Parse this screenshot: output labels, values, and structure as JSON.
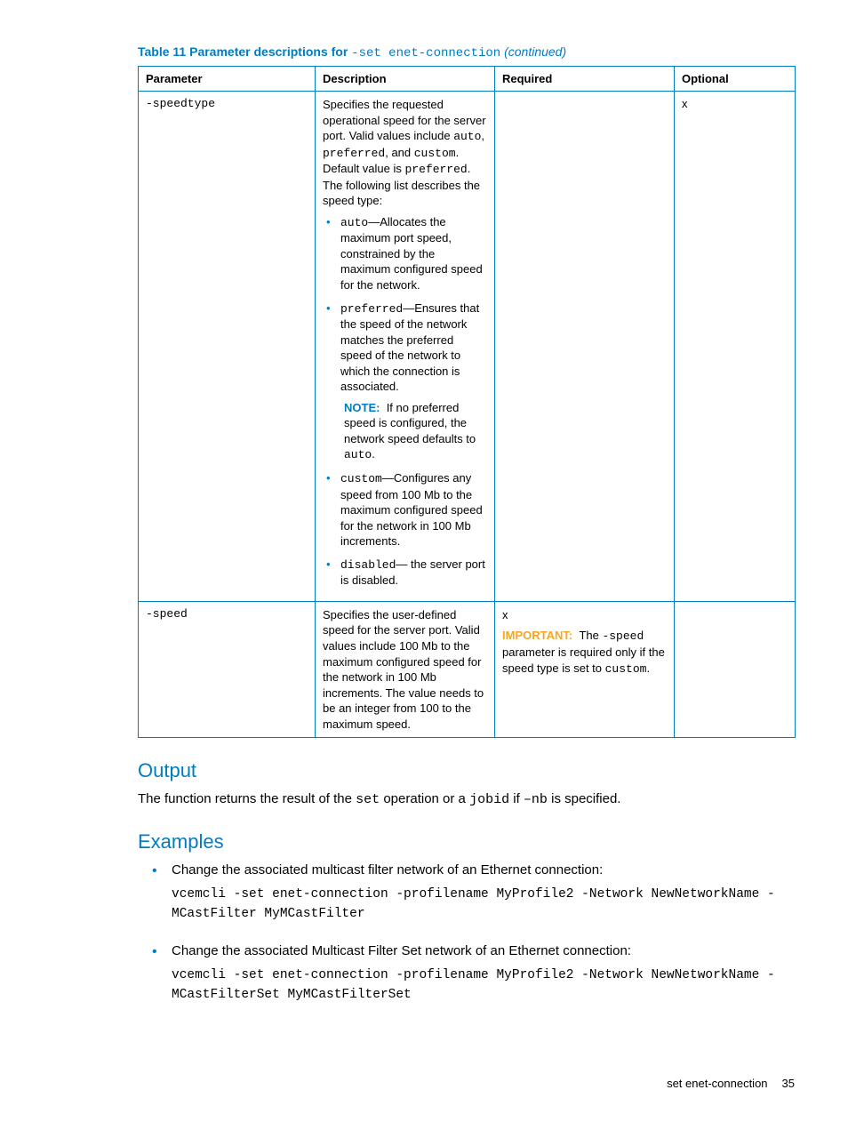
{
  "caption": {
    "prefix": "Table 11 Parameter descriptions for ",
    "code": "-set enet-connection",
    "suffix": " (continued)"
  },
  "headers": {
    "c1": "Parameter",
    "c2": "Description",
    "c3": "Required",
    "c4": "Optional"
  },
  "row1": {
    "param": "-speedtype",
    "desc_intro_a": "Specifies the requested operational speed for the server port. Valid values include ",
    "desc_code1": "auto",
    "desc_sep1": ", ",
    "desc_code2": "preferred",
    "desc_sep2": ", and ",
    "desc_code3": "custom",
    "desc_aftercodes": ". Default value is ",
    "desc_code4": "preferred",
    "desc_tail": ". The following list describes the speed type:",
    "b1_code": "auto",
    "b1_text": "—Allocates the maximum port speed, constrained by the maximum configured speed for the network.",
    "b2_code": "preferred",
    "b2_text": "—Ensures that the speed of the network matches the preferred speed of the network to which the connection is associated.",
    "b2_note_label": "NOTE:",
    "b2_note_text_a": "If no preferred speed is configured, the network speed defaults to ",
    "b2_note_code": "auto",
    "b2_note_text_b": ".",
    "b3_code": "custom",
    "b3_text": "—Configures any speed from 100 Mb to the maximum configured speed for the network in 100 Mb increments.",
    "b4_code": "disabled",
    "b4_text": "— the server port is disabled.",
    "required": "",
    "optional": "x"
  },
  "row2": {
    "param": "-speed",
    "desc": "Specifies the user-defined speed for the server port. Valid values include 100 Mb to the maximum configured speed for the network in 100 Mb increments. The value needs to be an integer from 100 to the maximum speed.",
    "req_x": "x",
    "imp_label": "IMPORTANT:",
    "imp_text_a": "The ",
    "imp_code": "-speed",
    "imp_text_b": " parameter is required only if the speed type is set to ",
    "imp_code2": "custom",
    "imp_text_c": ".",
    "optional": ""
  },
  "output": {
    "heading": "Output",
    "text_a": "The function returns the result of the ",
    "code1": "set",
    "text_b": " operation or a ",
    "code2": "jobid",
    "text_c": " if ",
    "code3": "–nb",
    "text_d": " is specified."
  },
  "examples": {
    "heading": "Examples",
    "item1_text": "Change the associated multicast filter network of an Ethernet connection:",
    "item1_cmd": "vcemcli -set enet-connection -profilename MyProfile2 -Network NewNetworkName -MCastFilter MyMCastFilter",
    "item2_text": "Change the associated Multicast Filter Set network of an Ethernet connection:",
    "item2_cmd": "vcemcli -set enet-connection -profilename MyProfile2 -Network NewNetworkName -MCastFilterSet MyMCastFilterSet"
  },
  "footer": {
    "section": "set enet-connection",
    "page": "35"
  }
}
